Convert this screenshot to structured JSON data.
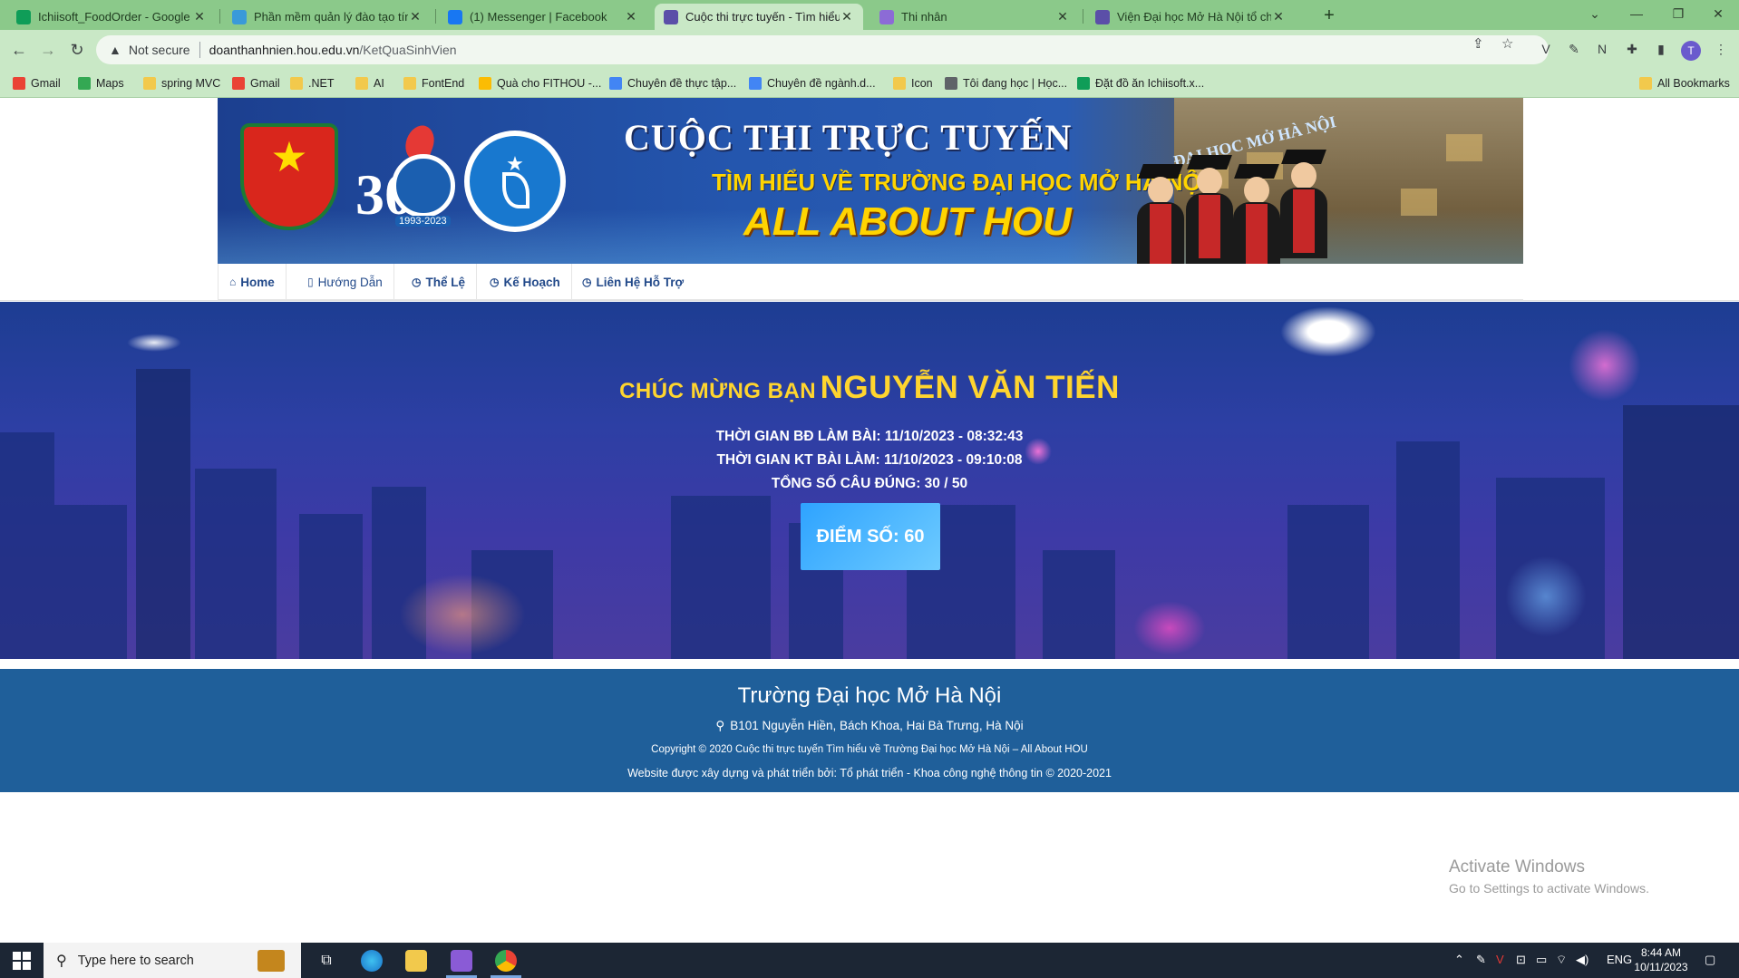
{
  "browser": {
    "tabs": [
      {
        "title": "Ichiisoft_FoodOrder - Google Tr...",
        "favicon_color": "#0f9d58",
        "active": false
      },
      {
        "title": "Phần mềm quản lý đào tạo tín c...",
        "favicon_color": "#3a9ad9",
        "active": false
      },
      {
        "title": "(1) Messenger | Facebook",
        "favicon_color": "#1877f2",
        "active": false
      },
      {
        "title": "Cuộc thi trực tuyến - Tìm hiểu về...",
        "favicon_color": "#5b4fa8",
        "active": true
      },
      {
        "title": "Thi nhân",
        "favicon_color": "#8c6bd6",
        "active": false
      },
      {
        "title": "Viện Đại học Mở Hà Nội tổ chức...",
        "favicon_color": "#5b4fa8",
        "active": false
      }
    ],
    "new_tab": "+",
    "security": "Not secure",
    "url_domain": "doanthanhnien.hou.edu.vn",
    "url_path": "/KetQuaSinhVien",
    "profile_initial": "T",
    "bookmarks": [
      {
        "label": "Gmail",
        "icon": "gmail-icon",
        "color": "#ea4335"
      },
      {
        "label": "Maps",
        "icon": "maps-icon",
        "color": "#34a853"
      },
      {
        "label": "spring MVC",
        "icon": "folder-icon",
        "color": "#f2c94c"
      },
      {
        "label": "Gmail",
        "icon": "gmail-icon",
        "color": "#ea4335"
      },
      {
        "label": ".NET",
        "icon": "folder-icon",
        "color": "#f2c94c"
      },
      {
        "label": "AI",
        "icon": "folder-icon",
        "color": "#f2c94c"
      },
      {
        "label": "FontEnd",
        "icon": "folder-icon",
        "color": "#f2c94c"
      },
      {
        "label": "Quà cho FITHOU -...",
        "icon": "drive-icon",
        "color": "#fbbc04"
      },
      {
        "label": "Chuyên đề thực tập...",
        "icon": "docs-icon",
        "color": "#4285f4"
      },
      {
        "label": "Chuyên đề ngành.d...",
        "icon": "docs-icon",
        "color": "#4285f4"
      },
      {
        "label": "Icon",
        "icon": "folder-icon",
        "color": "#f2c94c"
      },
      {
        "label": "Tôi đang học | Học...",
        "icon": "learning-icon",
        "color": "#5f6368"
      },
      {
        "label": "Đặt đồ ăn Ichiisoft.x...",
        "icon": "sheets-icon",
        "color": "#0f9d58"
      }
    ],
    "all_bookmarks": "All Bookmarks"
  },
  "banner": {
    "line1": "CUỘC THI TRỰC TUYẾN",
    "line2": "TÌM HIỂU VỀ TRƯỜNG ĐẠI HỌC MỞ HÀ NỘI",
    "line3": "ALL ABOUT HOU",
    "logo_30": "30",
    "logo_years": "1993-2023",
    "building_name": "ĐẠI HỌC MỞ HÀ NỘI"
  },
  "nav": [
    {
      "label": "Home",
      "icon": "home-icon",
      "glyph": "⌂"
    },
    {
      "label": "Hướng Dẫn",
      "icon": "guide-icon",
      "glyph": "▯"
    },
    {
      "label": "Thể Lệ",
      "icon": "clock-icon",
      "glyph": "◷"
    },
    {
      "label": "Kế Hoạch",
      "icon": "clock-icon",
      "glyph": "◷"
    },
    {
      "label": "Liên Hệ Hỗ Trợ",
      "icon": "clock-icon",
      "glyph": "◷"
    }
  ],
  "result": {
    "congrats": "CHÚC MỪNG BẠN",
    "student_name": "NGUYỄN VĂN TIẾN",
    "start_time": "THỜI GIAN BĐ LÀM BÀI: 11/10/2023 - 08:32:43",
    "end_time": "THỜI GIAN KT BÀI LÀM: 11/10/2023 - 09:10:08",
    "correct": "TỔNG SỐ CÂU ĐÚNG: 30 / 50",
    "score": "ĐIỂM SỐ: 60"
  },
  "footer": {
    "title": "Trường Đại học Mở Hà Nội",
    "address": "B101 Nguyễn Hiền, Bách Khoa, Hai Bà Trưng, Hà Nội",
    "copyright": "Copyright © 2020 Cuộc thi trực tuyến Tìm hiểu về Trường Đại học Mở Hà Nội – All About HOU",
    "developer": "Website được xây dựng và phát triển bởi: Tổ phát triển - Khoa công nghệ thông tin © 2020-2021"
  },
  "watermark": {
    "title": "Activate Windows",
    "subtitle": "Go to Settings to activate Windows."
  },
  "taskbar": {
    "search_placeholder": "Type here to search",
    "language": "ENG",
    "time": "8:44 AM",
    "date": "10/11/2023"
  }
}
